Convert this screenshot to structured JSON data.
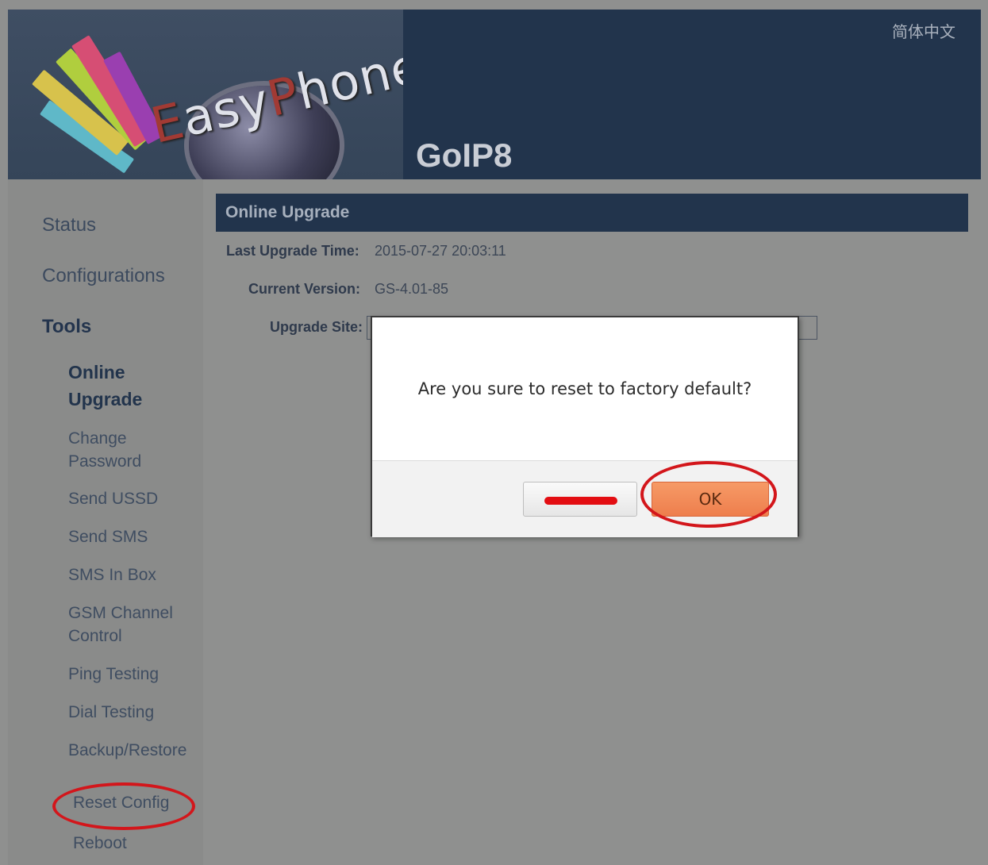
{
  "header": {
    "brand": {
      "first": "E",
      "mid": "asy",
      "p": "P",
      "rest": "hone"
    },
    "product_name": "GoIP8",
    "language_link": "简体中文"
  },
  "sidebar": {
    "status": "Status",
    "configurations": "Configurations",
    "tools": "Tools",
    "items": [
      {
        "line1": "Online",
        "line2": "Upgrade"
      },
      {
        "line1": "Change",
        "line2": "Password"
      },
      {
        "line1": "Send USSD"
      },
      {
        "line1": "Send SMS"
      },
      {
        "line1": "SMS In Box"
      },
      {
        "line1": "GSM Channel",
        "line2": "Control"
      },
      {
        "line1": "Ping Testing"
      },
      {
        "line1": "Dial Testing"
      },
      {
        "line1": "Backup/Restore"
      },
      {
        "line1": "Reset Config"
      },
      {
        "line1": "Reboot"
      }
    ]
  },
  "panel": {
    "title": "Online Upgrade",
    "last_upgrade_label": "Last Upgrade Time:",
    "last_upgrade_value": "2015-07-27 20:03:11",
    "current_version_label": "Current Version:",
    "current_version_value": "GS-4.01-85",
    "upgrade_site_label": "Upgrade Site:"
  },
  "dialog": {
    "message": "Are you sure to reset to factory default?",
    "ok_label": "OK"
  },
  "colors": {
    "header_bg": "#22344c",
    "page_bg": "#8f908f",
    "ok_button": "#f08a58",
    "highlight_red": "#d3161b"
  }
}
